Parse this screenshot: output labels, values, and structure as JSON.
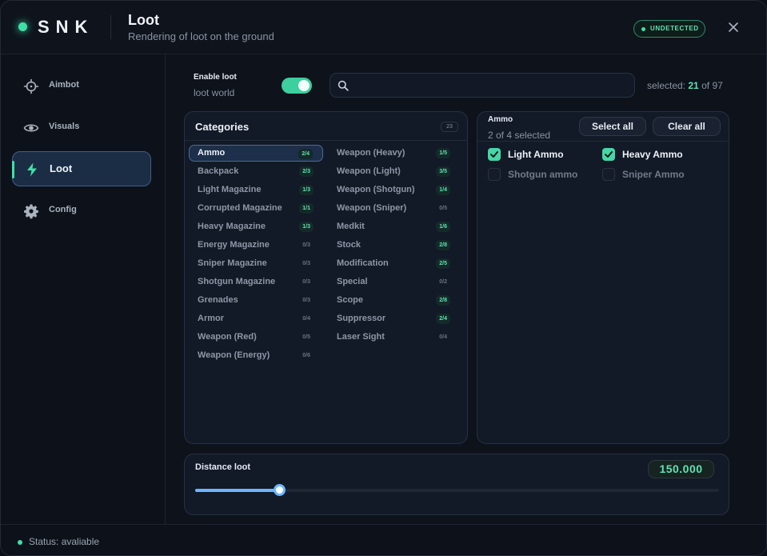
{
  "brand": "SNK",
  "header": {
    "title": "Loot",
    "subtitle": "Rendering of loot on the ground",
    "status_badge": "UNDETECTED"
  },
  "sidebar": {
    "items": [
      {
        "label": "Aimbot",
        "icon": "crosshair-icon"
      },
      {
        "label": "Visuals",
        "icon": "eye-icon"
      },
      {
        "label": "Loot",
        "icon": "bolt-icon",
        "active": true
      },
      {
        "label": "Config",
        "icon": "gear-icon"
      }
    ]
  },
  "enable": {
    "label": "Enable loot",
    "sublabel": "loot world",
    "on": true
  },
  "search": {
    "placeholder": "",
    "value": ""
  },
  "selection": {
    "prefix": "selected:",
    "count": "21",
    "of": "of",
    "total": "97"
  },
  "categories": {
    "title": "Categories",
    "count": "23",
    "left": [
      {
        "name": "Ammo",
        "badge": "2/4",
        "active": true
      },
      {
        "name": "Backpack",
        "badge": "2/3"
      },
      {
        "name": "Light Magazine",
        "badge": "1/3"
      },
      {
        "name": "Corrupted Magazine",
        "badge": "1/1"
      },
      {
        "name": "Heavy Magazine",
        "badge": "1/3"
      },
      {
        "name": "Energy Magazine",
        "badge": "0/3"
      },
      {
        "name": "Sniper Magazine",
        "badge": "0/3"
      },
      {
        "name": "Shotgun Magazine",
        "badge": "0/3"
      },
      {
        "name": "Grenades",
        "badge": "0/3"
      },
      {
        "name": "Armor",
        "badge": "0/4"
      },
      {
        "name": "Weapon (Red)",
        "badge": "0/5"
      },
      {
        "name": "Weapon (Energy)",
        "badge": "0/6"
      }
    ],
    "right": [
      {
        "name": "Weapon (Heavy)",
        "badge": "1/5"
      },
      {
        "name": "Weapon (Light)",
        "badge": "3/5"
      },
      {
        "name": "Weapon (Shotgun)",
        "badge": "1/4"
      },
      {
        "name": "Weapon (Sniper)",
        "badge": "0/5"
      },
      {
        "name": "Medkit",
        "badge": "1/6"
      },
      {
        "name": "Stock",
        "badge": "2/8"
      },
      {
        "name": "Modification",
        "badge": "2/5"
      },
      {
        "name": "Special",
        "badge": "0/2"
      },
      {
        "name": "Scope",
        "badge": "2/8"
      },
      {
        "name": "Suppressor",
        "badge": "2/4"
      },
      {
        "name": "Laser Sight",
        "badge": "0/4"
      }
    ]
  },
  "ammo": {
    "title": "Ammo",
    "subtitle": "2 of 4 selected",
    "select_all": "Select all",
    "clear_all": "Clear all",
    "items": [
      {
        "name": "Light Ammo",
        "checked": true
      },
      {
        "name": "Heavy Ammo",
        "checked": true
      },
      {
        "name": "Shotgun ammo",
        "checked": false
      },
      {
        "name": "Sniper Ammo",
        "checked": false
      }
    ]
  },
  "distance": {
    "label": "Distance loot",
    "value": "150.000",
    "fraction": 0.16
  },
  "footer": {
    "status": "Status: avaliable"
  },
  "colors": {
    "accent": "#3fe0a8",
    "slider": "#6bb5ff",
    "active_bg": "#1b2d45"
  }
}
